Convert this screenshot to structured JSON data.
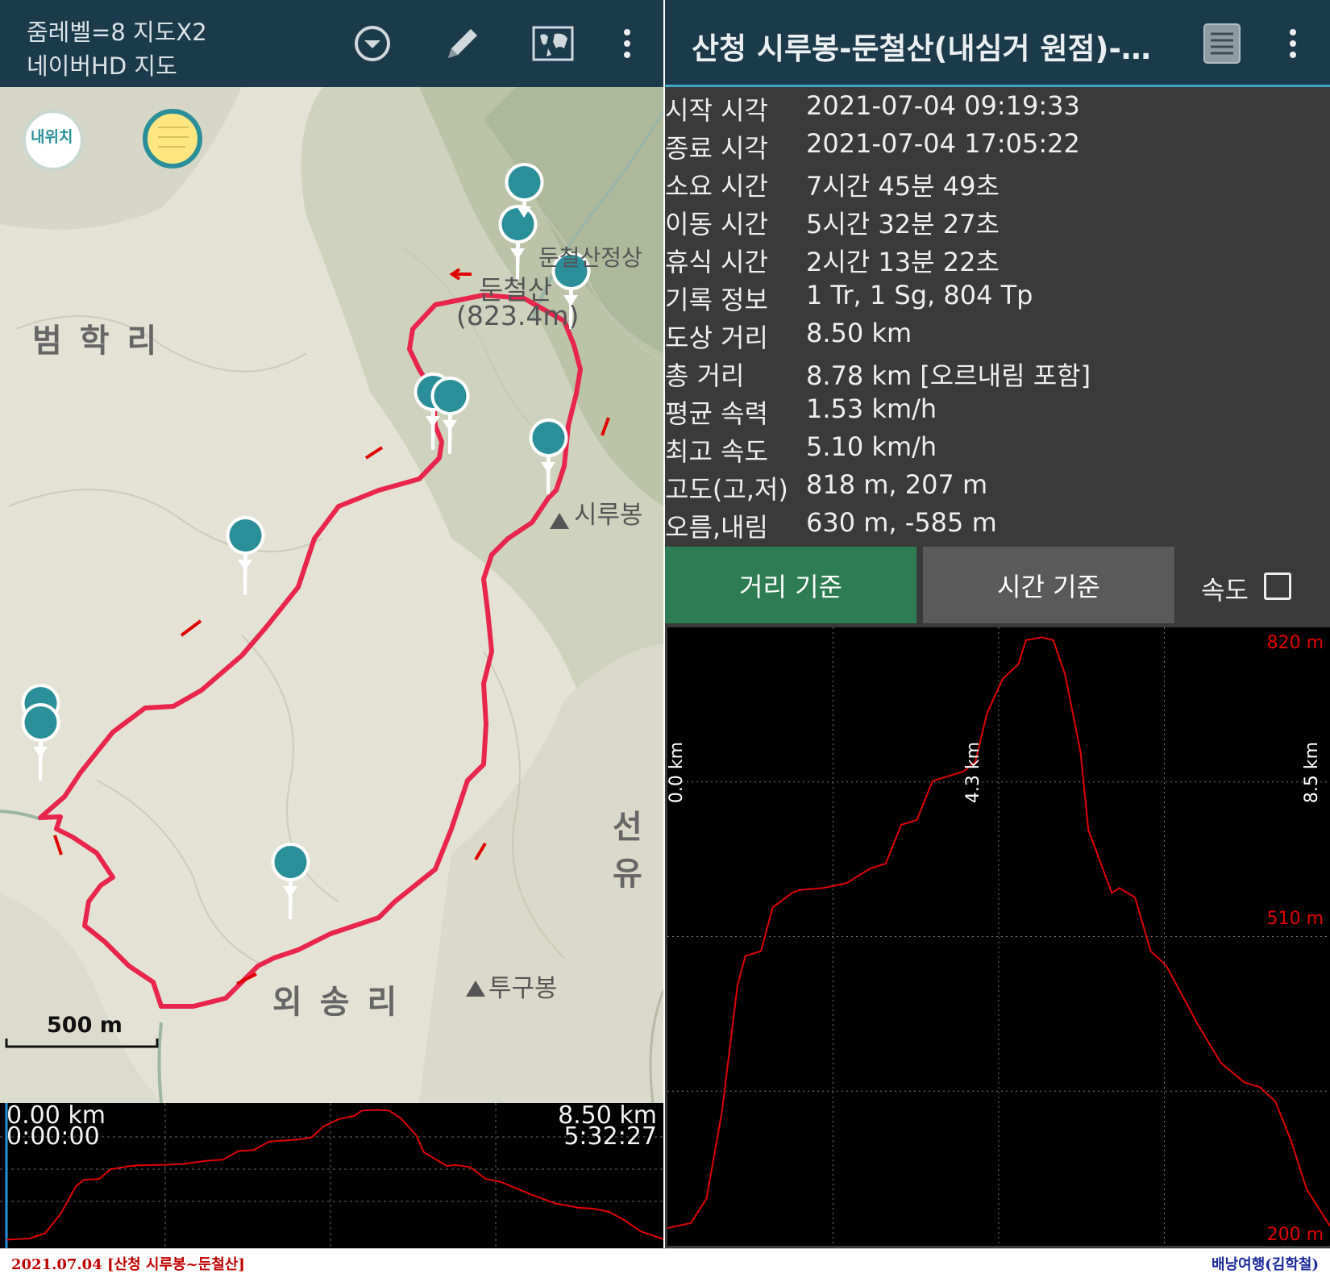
{
  "left": {
    "zoom_line1": "줌레벨=8 지도X2",
    "zoom_line2": "네이버HD 지도",
    "icons": [
      "dropdown-icon",
      "pencil-icon",
      "world-map-icon",
      "more-vert-icon"
    ],
    "my_location_label": "내위치",
    "places": {
      "beomhak": "범 학 리",
      "oesong": "외 송 리",
      "seonyu": "선유",
      "dunchulsan": "둔철산",
      "elevation": "(823.4m)",
      "dunchul_summit": "둔철산정상",
      "sirubong": "시루봉",
      "tugubong": "투구봉"
    },
    "scale_label": "500 m",
    "mini_profile": {
      "start_km": "0.00 km",
      "start_time": "0:00:00",
      "end_km": "8.50 km",
      "end_time": "5:32:27"
    }
  },
  "right": {
    "title": "산청 시루봉-둔철산(내심거 원점)-8...",
    "icons": [
      "list-icon",
      "more-vert-icon"
    ],
    "stats": [
      {
        "label": "시작 시각",
        "value": "2021-07-04 09:19:33"
      },
      {
        "label": "종료 시각",
        "value": "2021-07-04 17:05:22"
      },
      {
        "label": "소요 시간",
        "value": "7시간 45분 49초"
      },
      {
        "label": "이동 시간",
        "value": "5시간 32분 27초"
      },
      {
        "label": "휴식 시간",
        "value": "2시간 13분 22초"
      },
      {
        "label": "기록 정보",
        "value": "1 Tr, 1 Sg, 804 Tp"
      },
      {
        "label": "도상 거리",
        "value": "8.50 km"
      },
      {
        "label": "총 거리",
        "value": "8.78 km [오르내림 포함]"
      },
      {
        "label": "평균 속력",
        "value": "1.53 km/h"
      },
      {
        "label": "최고 속도",
        "value": "5.10 km/h"
      },
      {
        "label": "고도(고,저)",
        "value": "818 m, 207 m"
      },
      {
        "label": "오름,내림",
        "value": "630 m, -585 m"
      }
    ],
    "tab_distance": "거리 기준",
    "tab_time": "시간 기준",
    "speed_label": "속도",
    "speed_checked": false,
    "colors": {
      "accent": "#2e7d52",
      "topbar": "#1b3a4b",
      "profile": "#e00000"
    }
  },
  "chart_data": {
    "type": "line",
    "x_labels": [
      "0.0 km",
      "4.3 km",
      "8.5 km"
    ],
    "y_labels": [
      "820 m",
      "510 m",
      "200 m"
    ],
    "xlim": [
      0,
      8.5
    ],
    "ylim": [
      200,
      820
    ],
    "grid": true,
    "series": [
      {
        "x": [
          0,
          0.3,
          0.5,
          0.7,
          0.9,
          1.0,
          1.2,
          1.35,
          1.6,
          1.7,
          2.0,
          2.3,
          2.6,
          2.8,
          3.0,
          3.2,
          3.4,
          3.6,
          3.8,
          3.95,
          4.1,
          4.3,
          4.5,
          4.6,
          4.8,
          4.95,
          5.1,
          5.3,
          5.4,
          5.7,
          5.8,
          6.0,
          6.2,
          6.4,
          6.6,
          6.8,
          7.1,
          7.4,
          7.6,
          7.8,
          8.0,
          8.2,
          8.5
        ],
        "y": [
          210,
          215,
          240,
          330,
          460,
          490,
          495,
          540,
          555,
          558,
          560,
          565,
          580,
          585,
          625,
          630,
          670,
          675,
          680,
          690,
          740,
          775,
          790,
          815,
          818,
          815,
          780,
          700,
          620,
          555,
          560,
          550,
          495,
          480,
          450,
          420,
          380,
          360,
          355,
          340,
          300,
          250,
          212
        ]
      }
    ]
  }
}
